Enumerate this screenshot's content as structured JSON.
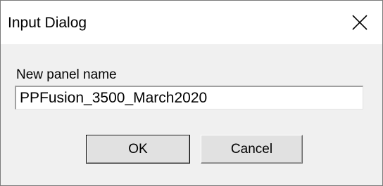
{
  "dialog": {
    "title": "Input Dialog",
    "close_icon": "close-icon"
  },
  "form": {
    "label": "New panel name",
    "value": "PPFusion_3500_March2020"
  },
  "buttons": {
    "ok_label": "OK",
    "cancel_label": "Cancel"
  }
}
